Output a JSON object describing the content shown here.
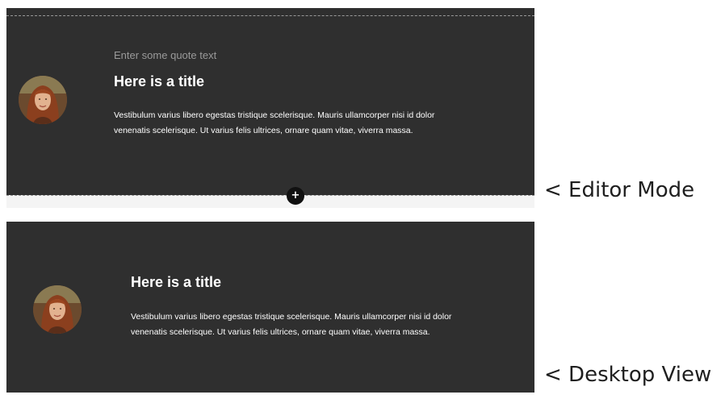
{
  "editor": {
    "quote_placeholder": "Enter some quote text",
    "title": "Here is a title",
    "body_line1": "Vestibulum varius libero egestas tristique scelerisque. Mauris ullamcorper nisi id dolor",
    "body_line2": "venenatis scelerisque. Ut varius felis ultrices, ornare quam vitae, viverra massa.",
    "add_button_glyph": "+",
    "add_button_icon": "plus-icon"
  },
  "desktop": {
    "title": "Here is a title",
    "body_line1": "Vestibulum varius libero egestas tristique scelerisque. Mauris ullamcorper nisi id dolor",
    "body_line2": "venenatis scelerisque. Ut varius felis ultrices, ornare quam vitae, viverra massa."
  },
  "labels": {
    "editor_mode": "< Editor Mode",
    "desktop_view": "< Desktop View"
  },
  "colors": {
    "panel_background": "#2f2f2f",
    "placeholder_text": "#9a9a9a",
    "primary_text": "#ffffff",
    "add_button": "#111111"
  }
}
